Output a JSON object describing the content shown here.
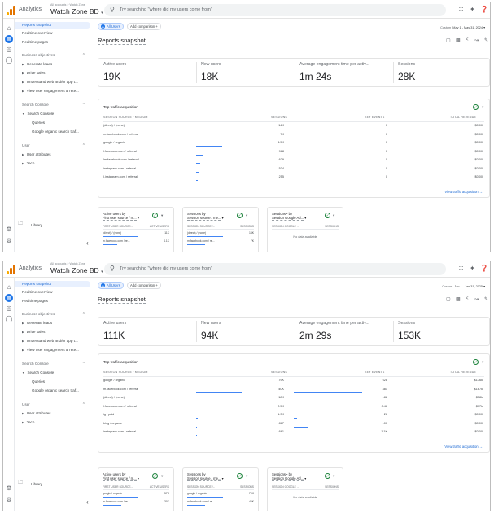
{
  "app": {
    "title": "Analytics",
    "breadcrumb": "All accounts > Watch Zone",
    "property": "Watch Zone BD",
    "search_placeholder": "Try searching \"where did my users come from\""
  },
  "nav": {
    "reports_snapshot": "Reports snapshot",
    "realtime_overview": "Realtime overview",
    "realtime_pages": "Realtime pages",
    "business_objectives": "Business objectives",
    "business_items": [
      "Generate leads",
      "Drive sales",
      "Understand web and/or app t...",
      "View user engagement & rete..."
    ],
    "search_console": "Search Console",
    "search_console_child": "Search Console",
    "queries": "Queries",
    "organic_search": "Google organic search traf...",
    "user": "User",
    "user_items": [
      "User attributes",
      "Tech"
    ],
    "library": "Library"
  },
  "comparison": {
    "all_users": "All Users",
    "add_comparison": "Add comparison +"
  },
  "report_title": "Reports snapshot",
  "traffic": {
    "title": "Top traffic acquisition",
    "headers": [
      "SESSION SOURCE / MEDIUM",
      "SESSIONS",
      "KEY EVENTS",
      "TOTAL REVENUE"
    ],
    "link": "View traffic acquisition →"
  },
  "cards": {
    "c1_title_1": "Active users by",
    "c1_title_2": "First user source / m...",
    "c1_h1": "FIRST USER SOURCE...",
    "c1_h2": "ACTIVE USERS",
    "c2_title_1": "Sessions by",
    "c2_title_2": "Session source / me...",
    "c2_h1": "SESSION SOURCE /...",
    "c2_h2": "SESSIONS",
    "c3_title_1": "Sessions~ by",
    "c3_title_2": "Session Google Ad...",
    "c3_h1": "SESSION GOOGLE ...",
    "c3_h2": "SESSIONS",
    "no_data": "No data available"
  },
  "panels": [
    {
      "date_label": "Custom",
      "date_range": "May 1 - May 31, 2024",
      "metrics": [
        {
          "label": "Active users",
          "value": "19K"
        },
        {
          "label": "New users",
          "value": "18K"
        },
        {
          "label": "Average engagement time per activ...",
          "value": "1m 24s"
        },
        {
          "label": "Sessions",
          "value": "28K"
        }
      ],
      "rows": [
        {
          "source": "(direct) / (none)",
          "sessions": "14K",
          "events": "0",
          "revenue": "$0.00",
          "bar": 0.5,
          "ebar": 0
        },
        {
          "source": "m.facebook.com / referral",
          "sessions": "7K",
          "events": "0",
          "revenue": "$0.00",
          "bar": 0.25,
          "ebar": 0
        },
        {
          "source": "google / organic",
          "sessions": "4.5K",
          "events": "0",
          "revenue": "$0.00",
          "bar": 0.16,
          "ebar": 0
        },
        {
          "source": "l.facebook.com / referral",
          "sessions": "988",
          "events": "0",
          "revenue": "$0.00",
          "bar": 0.04,
          "ebar": 0
        },
        {
          "source": "lm.facebook.com / referral",
          "sessions": "629",
          "events": "0",
          "revenue": "$0.00",
          "bar": 0.025,
          "ebar": 0
        },
        {
          "source": "instagram.com / referral",
          "sessions": "534",
          "events": "0",
          "revenue": "$0.00",
          "bar": 0.02,
          "ebar": 0
        },
        {
          "source": "l.instagram.com / referral",
          "sessions": "255",
          "events": "0",
          "revenue": "$0.00",
          "bar": 0.01,
          "ebar": 0
        }
      ],
      "card1": [
        {
          "k": "(direct) / (none)",
          "v": "11K",
          "bar": 0.55
        },
        {
          "k": "m.facebook.com / re...",
          "v": "4.1K",
          "bar": 0.22
        }
      ],
      "card2": [
        {
          "k": "(direct) / (none)",
          "v": "14K",
          "bar": 0.55
        },
        {
          "k": "m.facebook.com / re...",
          "v": "7K",
          "bar": 0.28
        }
      ]
    },
    {
      "date_label": "Custom",
      "date_range": "Jan 1 - Jan 31, 2025",
      "metrics": [
        {
          "label": "Active users",
          "value": "111K"
        },
        {
          "label": "New users",
          "value": "94K"
        },
        {
          "label": "Average engagement time per activ...",
          "value": "2m 29s"
        },
        {
          "label": "Sessions",
          "value": "153K"
        }
      ],
      "rows": [
        {
          "source": "google / organic",
          "sessions": "79K",
          "events": "628",
          "revenue": "$176k",
          "bar": 0.55,
          "ebar": 0.55
        },
        {
          "source": "m.facebook.com / referral",
          "sessions": "40K",
          "events": "481",
          "revenue": "$167k",
          "bar": 0.28,
          "ebar": 0.42
        },
        {
          "source": "(direct) / (none)",
          "sessions": "18K",
          "events": "188",
          "revenue": "$58k",
          "bar": 0.13,
          "ebar": 0.16
        },
        {
          "source": "l.facebook.com / referral",
          "sessions": "2.5K",
          "events": "0.46",
          "revenue": "$17k",
          "bar": 0.02,
          "ebar": 0.01
        },
        {
          "source": "ig / paid",
          "sessions": "1.3K",
          "events": "26",
          "revenue": "$0.00",
          "bar": 0.01,
          "ebar": 0.02
        },
        {
          "source": "bing / organic",
          "sessions": "867",
          "events": "100",
          "revenue": "$0.00",
          "bar": 0.006,
          "ebar": 0.09
        },
        {
          "source": "instagram.com / referral",
          "sessions": "661",
          "events": "1.1K",
          "revenue": "$0.00",
          "bar": 0.005,
          "ebar": 0
        }
      ],
      "card1": [
        {
          "k": "google / organic",
          "v": "57K",
          "bar": 0.55
        },
        {
          "k": "m.facebook.com / re...",
          "v": "30K",
          "bar": 0.29
        }
      ],
      "card2": [
        {
          "k": "google / organic",
          "v": "79K",
          "bar": 0.55
        },
        {
          "k": "m.facebook.com / re...",
          "v": "40K",
          "bar": 0.28
        }
      ]
    }
  ]
}
